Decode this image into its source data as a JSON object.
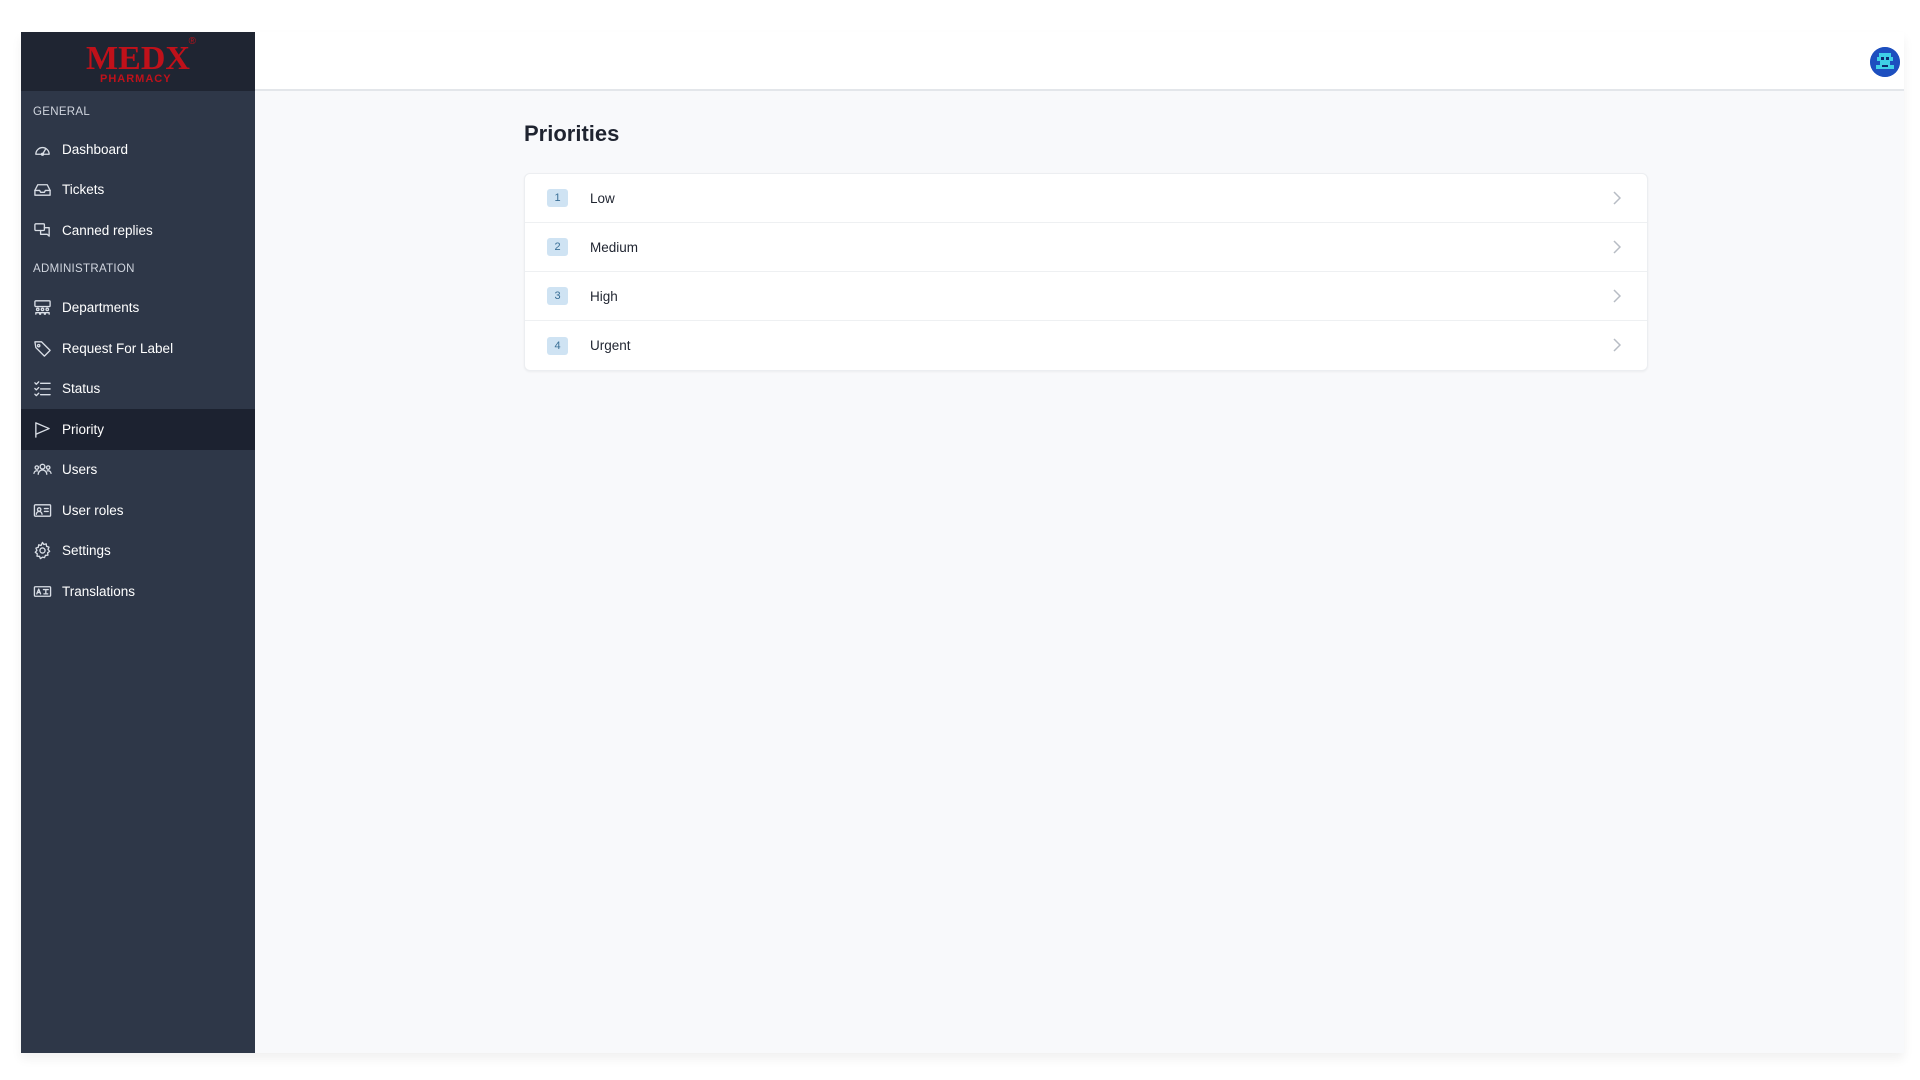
{
  "brand": {
    "logo_main": "MEDX",
    "logo_sub": "PHARMACY",
    "logo_reg": "®"
  },
  "sidebar": {
    "general_label": "GENERAL",
    "admin_label": "ADMINISTRATION",
    "general_items": [
      {
        "label": "Dashboard",
        "icon": "gauge-icon"
      },
      {
        "label": "Tickets",
        "icon": "inbox-icon"
      },
      {
        "label": "Canned replies",
        "icon": "chat-bubbles-icon"
      }
    ],
    "admin_items": [
      {
        "label": "Departments",
        "icon": "building-icon"
      },
      {
        "label": "Request For Label",
        "icon": "tag-icon"
      },
      {
        "label": "Status",
        "icon": "checklist-icon"
      },
      {
        "label": "Priority",
        "icon": "flag-icon",
        "active": true
      },
      {
        "label": "Users",
        "icon": "users-icon"
      },
      {
        "label": "User roles",
        "icon": "id-card-icon"
      },
      {
        "label": "Settings",
        "icon": "gear-icon"
      },
      {
        "label": "Translations",
        "icon": "translate-icon"
      }
    ]
  },
  "main": {
    "title": "Priorities",
    "priorities": [
      {
        "number": "1",
        "label": "Low"
      },
      {
        "number": "2",
        "label": "Medium"
      },
      {
        "number": "3",
        "label": "High"
      },
      {
        "number": "4",
        "label": "Urgent"
      }
    ]
  },
  "colors": {
    "sidebar_bg": "#2e3748",
    "sidebar_active": "#1c2230",
    "logo_red": "#c0111a",
    "badge_bg": "#cfe3f3",
    "avatar_blue": "#1d4fbf"
  }
}
